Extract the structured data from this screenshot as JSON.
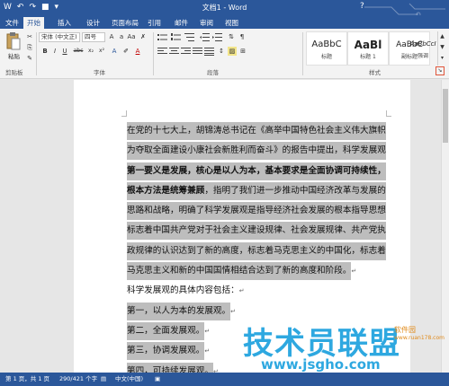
{
  "window": {
    "title": "文档1 - Word",
    "help": "?"
  },
  "tabs": [
    {
      "label": "文件"
    },
    {
      "label": "开始"
    },
    {
      "label": "插入"
    },
    {
      "label": "设计"
    },
    {
      "label": "页面布局"
    },
    {
      "label": "引用"
    },
    {
      "label": "邮件"
    },
    {
      "label": "审阅"
    },
    {
      "label": "视图"
    }
  ],
  "ribbon": {
    "paste_label": "粘贴",
    "clipboard_label": "剪贴板",
    "font_label": "字体",
    "paragraph_label": "段落",
    "styles_label": "样式",
    "font_name": "宋体 (中文正)",
    "font_size": "四号",
    "bold": "B",
    "italic": "I",
    "underline": "U",
    "strike": "abc",
    "subscript": "x₂",
    "superscript": "x²",
    "font_color": "A",
    "styles": [
      {
        "sample": "AaBbC",
        "name": "标题"
      },
      {
        "sample": "AaBl",
        "name": "标题 1"
      },
      {
        "sample": "AaBbC",
        "name": "副标题"
      },
      {
        "sample": "AaBbCcI",
        "name": "强调"
      }
    ]
  },
  "document": {
    "lines": [
      {
        "text": "在党的十七大上，胡锦涛总书记在《高举中国特色社会主义伟大旗帜",
        "bold": false
      },
      {
        "text": "为夺取全面建设小康社会新胜利而奋斗》的报告中提出，科学发展观",
        "bold": false
      },
      {
        "text": "第一要义是发展，核心是以人为本，基本要求是全面协调可持续性，",
        "bold": true
      },
      {
        "text": "根本方法是统筹兼顾",
        "bold": true,
        "rest": "，指明了我们进一步推动中国经济改革与发展的"
      },
      {
        "text": "思路和战略，明确了科学发展观是指导经济社会发展的根本指导思想，",
        "bold": false
      },
      {
        "text": "标志着中国共产党对于社会主义建设规律、社会发展规律、共产党执",
        "bold": false
      },
      {
        "text": "政规律的认识达到了新的高度，标志着马克思主义的中国化，标志着",
        "bold": false
      },
      {
        "text": "马克思主义和新的中国国情相结合达到了新的高度和阶段。",
        "bold": false,
        "mark": "↵"
      },
      {
        "text": "科学发展观的具体内容包括：",
        "bold": false,
        "unselected": true,
        "mark": "↵"
      },
      {
        "text": "第一，以人为本的发展观。",
        "bold": false,
        "mark": "↵"
      },
      {
        "text": "第二，全面发展观。",
        "bold": false,
        "mark": "↵"
      },
      {
        "text": "第三，协调发展观。",
        "bold": false,
        "mark": "↵"
      },
      {
        "text": "第四，可持续发展观。",
        "bold": false,
        "mark": "↵"
      }
    ]
  },
  "watermark": {
    "big": "技术员联盟",
    "url": "www.jsgho.com",
    "small1": "软件园",
    "small2": "www.ruan178.com"
  },
  "status": {
    "page": "第 1 页，共 1 页",
    "words": "290/421 个字",
    "lang": "中文(中国)"
  },
  "colors": {
    "accent": "#2b579a",
    "selection": "#bdbdbd",
    "watermark": "#2ea8e0"
  }
}
